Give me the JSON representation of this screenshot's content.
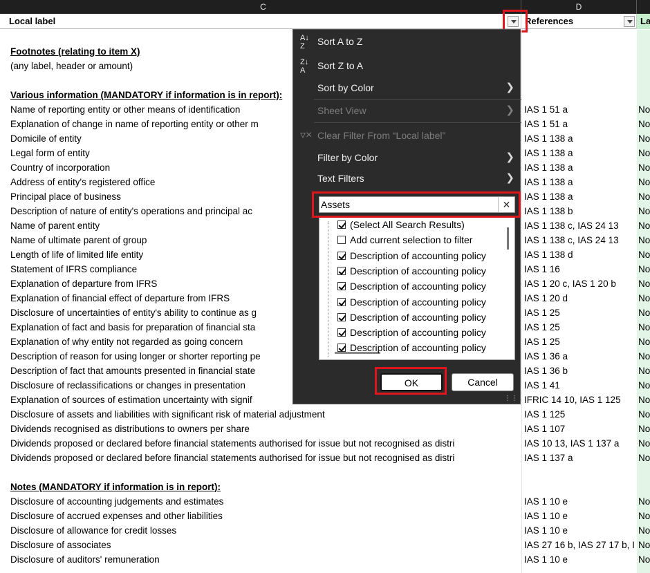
{
  "column_headers": {
    "c": "C",
    "d": "D"
  },
  "filter_header": {
    "local_label": "Local label",
    "references": "References",
    "third": "La"
  },
  "rows": [
    {
      "label": "",
      "ref": "",
      "nc": ""
    },
    {
      "label": "Footnotes (relating to item X)",
      "ref": "",
      "nc": "",
      "section": true
    },
    {
      "label": "(any label, header or amount)",
      "ref": "",
      "nc": ""
    },
    {
      "label": "",
      "ref": "",
      "nc": ""
    },
    {
      "label": "Various information (MANDATORY if information is in report):",
      "ref": "",
      "nc": "",
      "section": true
    },
    {
      "label": "Name of reporting entity or other means of identification",
      "ref": "IAS 1 51 a",
      "nc": "No"
    },
    {
      "label": "Explanation of change in name of reporting entity or other m",
      "ref": "IAS 1 51 a",
      "nc": "No"
    },
    {
      "label": "Domicile of entity",
      "ref": "IAS 1 138 a",
      "nc": "No"
    },
    {
      "label": "Legal form of entity",
      "ref": "IAS 1 138 a",
      "nc": "No"
    },
    {
      "label": "Country of incorporation",
      "ref": "IAS 1 138 a",
      "nc": "No"
    },
    {
      "label": "Address of entity's registered office",
      "ref": "IAS 1 138 a",
      "nc": "No"
    },
    {
      "label": "Principal place of business",
      "ref": "IAS 1 138 a",
      "nc": "No"
    },
    {
      "label": "Description of nature of entity's operations and principal ac",
      "ref": "IAS 1 138 b",
      "nc": "No"
    },
    {
      "label": "Name of parent entity",
      "ref": "IAS 1 138 c, IAS 24 13",
      "nc": "No"
    },
    {
      "label": "Name of ultimate parent of group",
      "ref": "IAS 1 138 c, IAS 24 13",
      "nc": "No"
    },
    {
      "label": "Length of life of limited life entity",
      "ref": "IAS 1 138 d",
      "nc": "No"
    },
    {
      "label": "Statement of IFRS compliance",
      "ref": "IAS 1 16",
      "nc": "No"
    },
    {
      "label": "Explanation of departure from IFRS",
      "ref": "IAS 1 20 c, IAS 1 20 b",
      "nc": "No"
    },
    {
      "label": "Explanation of financial effect of departure from IFRS",
      "ref": "IAS 1 20 d",
      "nc": "No"
    },
    {
      "label": "Disclosure of uncertainties of entity's ability to continue as g",
      "ref": "IAS 1 25",
      "nc": "No"
    },
    {
      "label": "Explanation of fact and basis for preparation of financial sta",
      "ref": "IAS 1 25",
      "nc": "No"
    },
    {
      "label": "Explanation of why entity not regarded as going concern",
      "ref": "IAS 1 25",
      "nc": "No"
    },
    {
      "label": "Description of reason for using longer or shorter reporting pe",
      "ref": "IAS 1 36 a",
      "nc": "No"
    },
    {
      "label": "Description of fact that amounts presented in financial state",
      "ref": "IAS 1 36 b",
      "nc": "No"
    },
    {
      "label": "Disclosure of reclassifications or changes in presentation",
      "ref": "IAS 1 41",
      "nc": "No"
    },
    {
      "label": "Explanation of sources of estimation uncertainty with signif",
      "ref": "IFRIC 14 10, IAS 1 125",
      "nc": "No"
    },
    {
      "label": "Disclosure of assets and liabilities with significant risk of material adjustment",
      "ref": "IAS 1 125",
      "nc": "No"
    },
    {
      "label": "Dividends recognised as distributions to owners per share",
      "ref": "IAS 1 107",
      "nc": "No"
    },
    {
      "label": "Dividends proposed or declared before financial statements authorised for issue but not recognised as distri",
      "ref": "IAS 10 13, IAS 1 137 a",
      "nc": "No"
    },
    {
      "label": "Dividends proposed or declared before financial statements authorised for issue but not recognised as distri",
      "ref": "IAS 1 137 a",
      "nc": "No"
    },
    {
      "label": "",
      "ref": "",
      "nc": ""
    },
    {
      "label": "Notes (MANDATORY if information is in report):",
      "ref": "",
      "nc": "",
      "section": true
    },
    {
      "label": "Disclosure of accounting judgements and estimates",
      "ref": "IAS 1 10 e",
      "nc": "No"
    },
    {
      "label": "Disclosure of accrued expenses and other liabilities",
      "ref": "IAS 1 10 e",
      "nc": "No"
    },
    {
      "label": "Disclosure of allowance for credit losses",
      "ref": "IAS 1 10 e",
      "nc": "No"
    },
    {
      "label": "Disclosure of associates",
      "ref": "IAS 27 16 b, IAS 27 17 b, I",
      "nc": "No"
    },
    {
      "label": "Disclosure of auditors' remuneration",
      "ref": "IAS 1 10 e",
      "nc": "No"
    }
  ],
  "menu": {
    "sort_az": "Sort A to Z",
    "sort_za": "Sort Z to A",
    "sort_by_color": "Sort by Color",
    "sheet_view": "Sheet View",
    "clear_filter": "Clear Filter From “Local label”",
    "filter_by_color": "Filter by Color",
    "text_filters": "Text Filters",
    "search_value": "Assets",
    "list_items": [
      {
        "label": "(Select All Search Results)",
        "checked": true,
        "indent": 0
      },
      {
        "label": "Add current selection to filter",
        "checked": false,
        "indent": 0
      },
      {
        "label": "Description of accounting policy",
        "checked": true,
        "indent": 0
      },
      {
        "label": "Description of accounting policy",
        "checked": true,
        "indent": 0
      },
      {
        "label": "Description of accounting policy",
        "checked": true,
        "indent": 0
      },
      {
        "label": "Description of accounting policy",
        "checked": true,
        "indent": 0
      },
      {
        "label": "Description of accounting policy",
        "checked": true,
        "indent": 0
      },
      {
        "label": "Description of accounting policy",
        "checked": true,
        "indent": 0
      },
      {
        "label": "Description of accounting policy",
        "checked": true,
        "indent": 0
      }
    ],
    "ok_label": "OK",
    "cancel_label": "Cancel"
  },
  "colors": {
    "highlight": "#e0161f",
    "menu_bg": "#2b2b2b",
    "green_column": "#c6efce"
  }
}
